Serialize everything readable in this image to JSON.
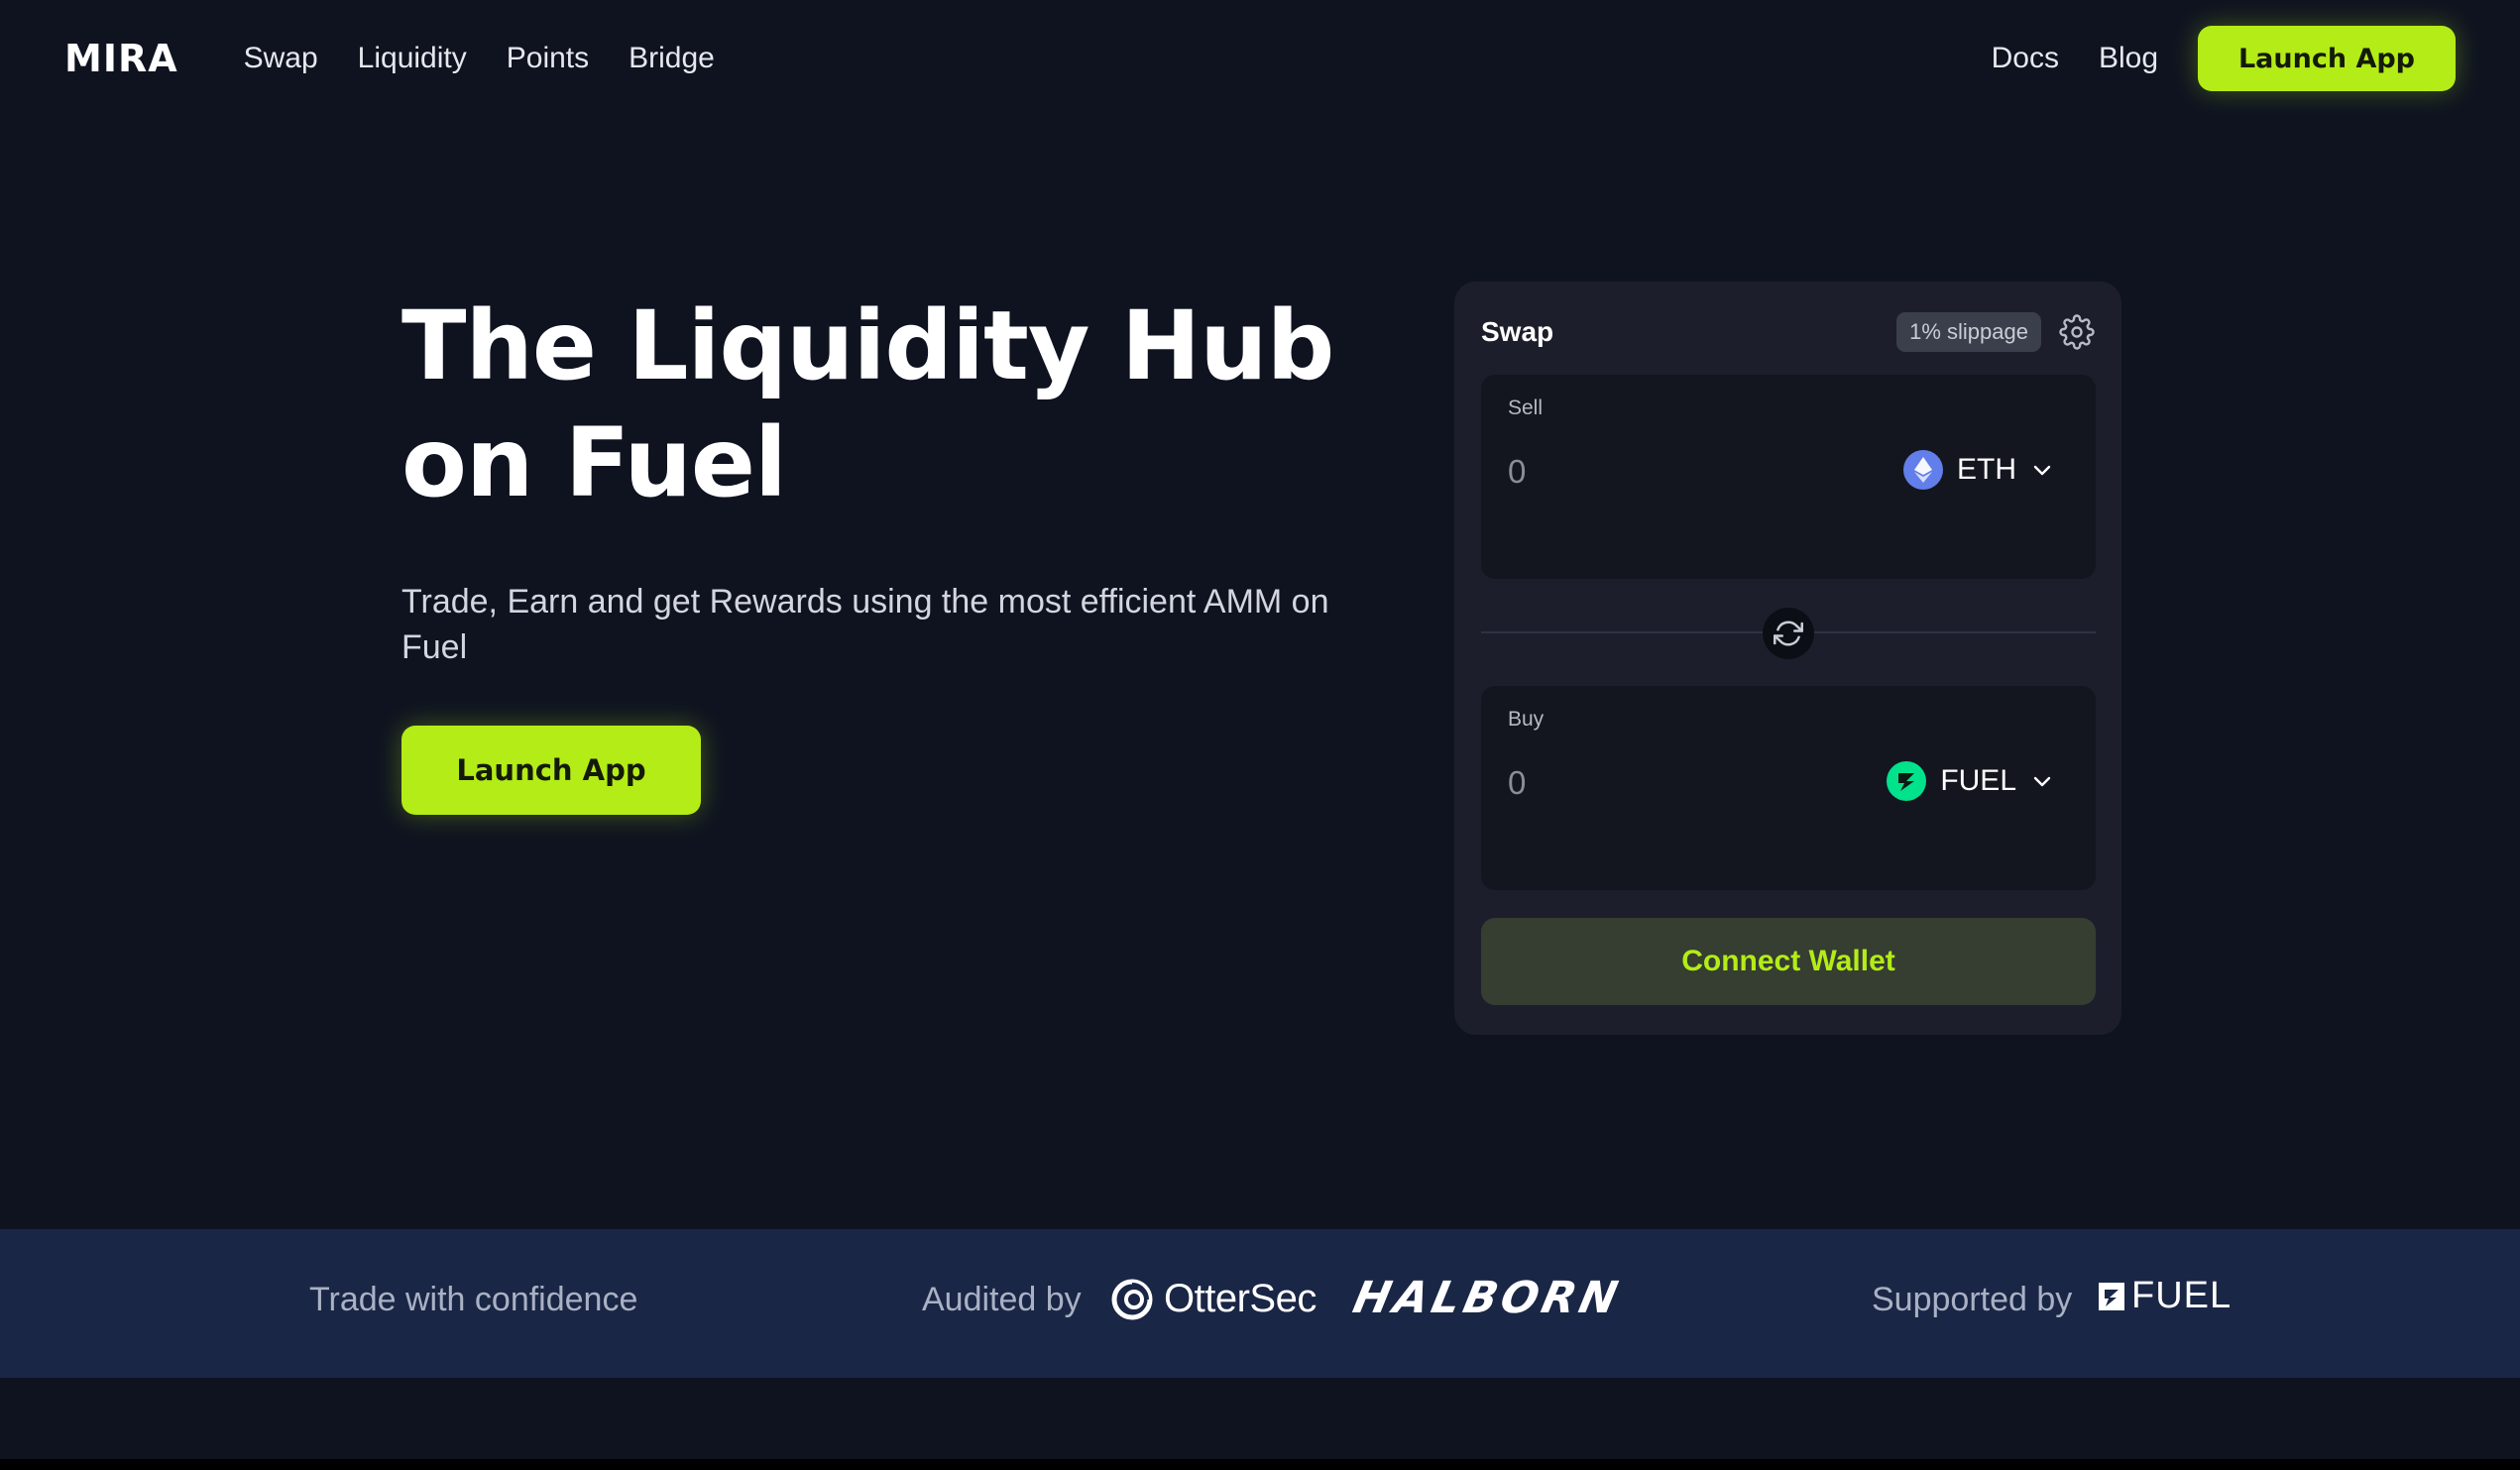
{
  "header": {
    "logo": "MIRA",
    "nav": [
      "Swap",
      "Liquidity",
      "Points",
      "Bridge"
    ],
    "right_links": [
      "Docs",
      "Blog"
    ],
    "cta": "Launch App"
  },
  "hero": {
    "title_line1": "The Liquidity Hub",
    "title_line2": "on Fuel",
    "subtitle": "Trade, Earn and get Rewards using the most efficient AMM on Fuel",
    "cta": "Launch App"
  },
  "swap": {
    "title": "Swap",
    "slippage": "1% slippage",
    "sell": {
      "label": "Sell",
      "amount": "0",
      "token": "ETH",
      "icon": "eth-icon"
    },
    "buy": {
      "label": "Buy",
      "amount": "0",
      "token": "FUEL",
      "icon": "fuel-icon"
    },
    "connect": "Connect Wallet"
  },
  "trust": {
    "tagline": "Trade with confidence",
    "audited_label": "Audited by",
    "auditors": [
      "OtterSec",
      "HALBORN"
    ],
    "supported_label": "Supported by",
    "supporter": "FUEL"
  },
  "colors": {
    "background": "#0f1320",
    "accent": "#b3ec17",
    "card": "#1c1f2b",
    "trust_bar": "#1a2645"
  }
}
